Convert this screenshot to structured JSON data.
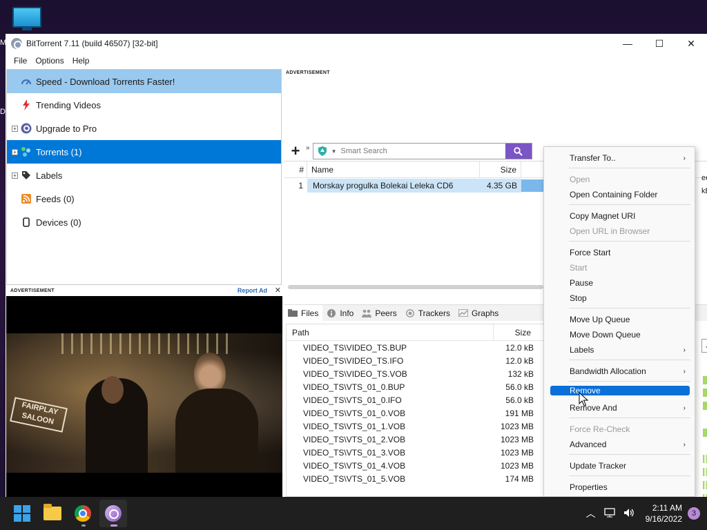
{
  "desktop": {
    "edge_letter_top": "M",
    "edge_letter_mid": "D"
  },
  "window": {
    "title": "BitTorrent 7.11  (build 46507) [32-bit]",
    "controls": {
      "minimize": "—",
      "maximize": "☐",
      "close": "✕"
    }
  },
  "menu": [
    "File",
    "Options",
    "Help"
  ],
  "sidebar": {
    "items": [
      {
        "label": "Speed - Download Torrents Faster!",
        "icon": "speed-gauge-icon"
      },
      {
        "label": "Trending Videos",
        "icon": "lightning-icon"
      },
      {
        "label": "Upgrade to Pro",
        "icon": "bittorrent-logo-icon"
      },
      {
        "label": "Torrents (1)",
        "icon": "torrents-icon"
      },
      {
        "label": "Labels",
        "icon": "tag-icon"
      },
      {
        "label": "Feeds (0)",
        "icon": "rss-icon"
      },
      {
        "label": "Devices (0)",
        "icon": "device-icon"
      }
    ]
  },
  "ads": {
    "top_label": "ADVERTISEMENT",
    "left_label": "ADVERTISEMENT",
    "report": "Report Ad",
    "close": "✕",
    "video_sign": "FAIRPLAY SALOON"
  },
  "toolbar": {
    "more": "»",
    "search_placeholder": "Smart Search"
  },
  "torrent_list": {
    "headers": {
      "num": "#",
      "name": "Name",
      "size": "Size"
    },
    "rows": [
      {
        "num": "1",
        "name": "Morskay progulka Bolekai Leleka CD6",
        "size": "4.35 GB"
      }
    ]
  },
  "tabs": [
    "Files",
    "Info",
    "Peers",
    "Trackers",
    "Graphs"
  ],
  "files": {
    "headers": {
      "path": "Path",
      "size": "Size"
    },
    "rows": [
      {
        "path": "VIDEO_TS\\VIDEO_TS.BUP",
        "size": "12.0 kB"
      },
      {
        "path": "VIDEO_TS\\VIDEO_TS.IFO",
        "size": "12.0 kB"
      },
      {
        "path": "VIDEO_TS\\VIDEO_TS.VOB",
        "size": "132 kB"
      },
      {
        "path": "VIDEO_TS\\VTS_01_0.BUP",
        "size": "56.0 kB"
      },
      {
        "path": "VIDEO_TS\\VTS_01_0.IFO",
        "size": "56.0 kB"
      },
      {
        "path": "VIDEO_TS\\VTS_01_0.VOB",
        "size": "191 MB"
      },
      {
        "path": "VIDEO_TS\\VTS_01_1.VOB",
        "size": "1023 MB"
      },
      {
        "path": "VIDEO_TS\\VTS_01_2.VOB",
        "size": "1023 MB"
      },
      {
        "path": "VIDEO_TS\\VTS_01_3.VOB",
        "size": "1023 MB"
      },
      {
        "path": "VIDEO_TS\\VTS_01_4.VOB",
        "size": "1023 MB"
      },
      {
        "path": "VIDEO_TS\\VTS_01_5.VOB",
        "size": "174 MB"
      }
    ]
  },
  "context_menu": {
    "transfer_to": "Transfer To..",
    "open": "Open",
    "open_folder": "Open Containing Folder",
    "copy_magnet": "Copy Magnet URI",
    "open_url": "Open URL in Browser",
    "force_start": "Force Start",
    "start": "Start",
    "pause": "Pause",
    "stop": "Stop",
    "move_up": "Move Up Queue",
    "move_down": "Move Down Queue",
    "labels": "Labels",
    "bandwidth": "Bandwidth Allocation",
    "remove": "Remove",
    "remove_and": "Remove And",
    "force_recheck": "Force Re-Check",
    "advanced": "Advanced",
    "update_tracker": "Update Tracker",
    "properties": "Properties",
    "arrow": "›"
  },
  "peek": {
    "col_head": "ee",
    "speed": "kB/"
  },
  "taskbar": {
    "time": "2:11 AM",
    "date": "9/16/2022",
    "notifications": "3",
    "tray_chevron": "︿"
  },
  "colors": {
    "accent": "#0078d7",
    "hover": "#99c9ef",
    "search_button": "#7b54c6",
    "menu_highlight": "#0a6fd8"
  }
}
